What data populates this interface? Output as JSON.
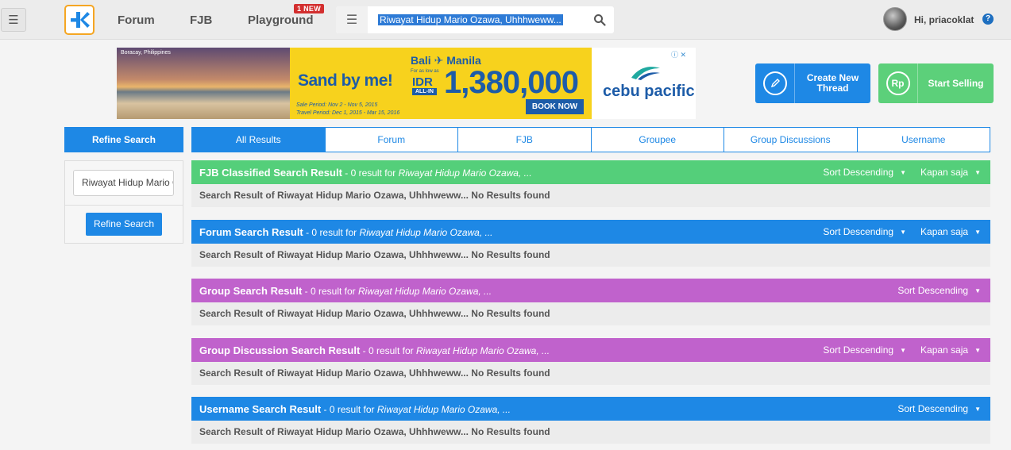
{
  "nav": {
    "forum": "Forum",
    "fjb": "FJB",
    "playground": "Playground",
    "badge": "1 NEW",
    "search_value": "Riwayat Hidup Mario Ozawa, Uhhhweww...",
    "greeting": "Hi, priacoklat",
    "help": "?"
  },
  "ad": {
    "photo_label": "Boracay, Philippines",
    "tagline": "Sand by me!",
    "route_from": "Bali",
    "route_to": "Manila",
    "small_text": "For as low as",
    "currency": "IDR",
    "all_in": "ALL-IN",
    "price": "1,380,000",
    "book": "BOOK NOW",
    "sale_period": "Sale Period: Nov 2 - Nov 5, 2015",
    "travel_period": "Travel Period: Dec 1, 2015 - Mar 15, 2016",
    "brand": "cebu pacific"
  },
  "actions": {
    "create_label_1": "Create New",
    "create_label_2": "Thread",
    "sell_label": "Start Selling",
    "sell_icon_text": "Rp"
  },
  "refine": {
    "title": "Refine Search",
    "input_value": "Riwayat Hidup Mario Ozawa",
    "button": "Refine Search"
  },
  "tabs": [
    "All Results",
    "Forum",
    "FJB",
    "Groupee",
    "Group Discussions",
    "Username"
  ],
  "sort_label": "Sort Descending",
  "time_label": "Kapan saja",
  "sections": [
    {
      "title": "FJB Classified Search Result",
      "meta": " - 0 result for ",
      "query": "Riwayat Hidup Mario Ozawa, ...",
      "body_prefix": "Search Result of Riwayat Hidup Mario Ozawa, Uhhhweww...",
      "body_status": " No Results found"
    },
    {
      "title": "Forum Search Result",
      "meta": " - 0 result for ",
      "query": "Riwayat Hidup Mario Ozawa, ...",
      "body_prefix": "Search Result of Riwayat Hidup Mario Ozawa, Uhhhweww...",
      "body_status": " No Results found"
    },
    {
      "title": "Group Search Result",
      "meta": " - 0 result for ",
      "query": "Riwayat Hidup Mario Ozawa, ...",
      "body_prefix": "Search Result of Riwayat Hidup Mario Ozawa, Uhhhweww...",
      "body_status": " No Results found"
    },
    {
      "title": "Group Discussion Search Result",
      "meta": " - 0 result for ",
      "query": "Riwayat Hidup Mario Ozawa, ...",
      "body_prefix": "Search Result of Riwayat Hidup Mario Ozawa, Uhhhweww...",
      "body_status": " No Results found"
    },
    {
      "title": "Username Search Result",
      "meta": " - 0 result for ",
      "query": "Riwayat Hidup Mario Ozawa, ...",
      "body_prefix": "Search Result of Riwayat Hidup Mario Ozawa, Uhhhweww...",
      "body_status": " No Results found"
    }
  ],
  "colors": {
    "primary": "#1e88e5",
    "fjb_green": "#54cf7a",
    "group_purple": "#c062cc",
    "logo_orange": "#f5a623"
  }
}
